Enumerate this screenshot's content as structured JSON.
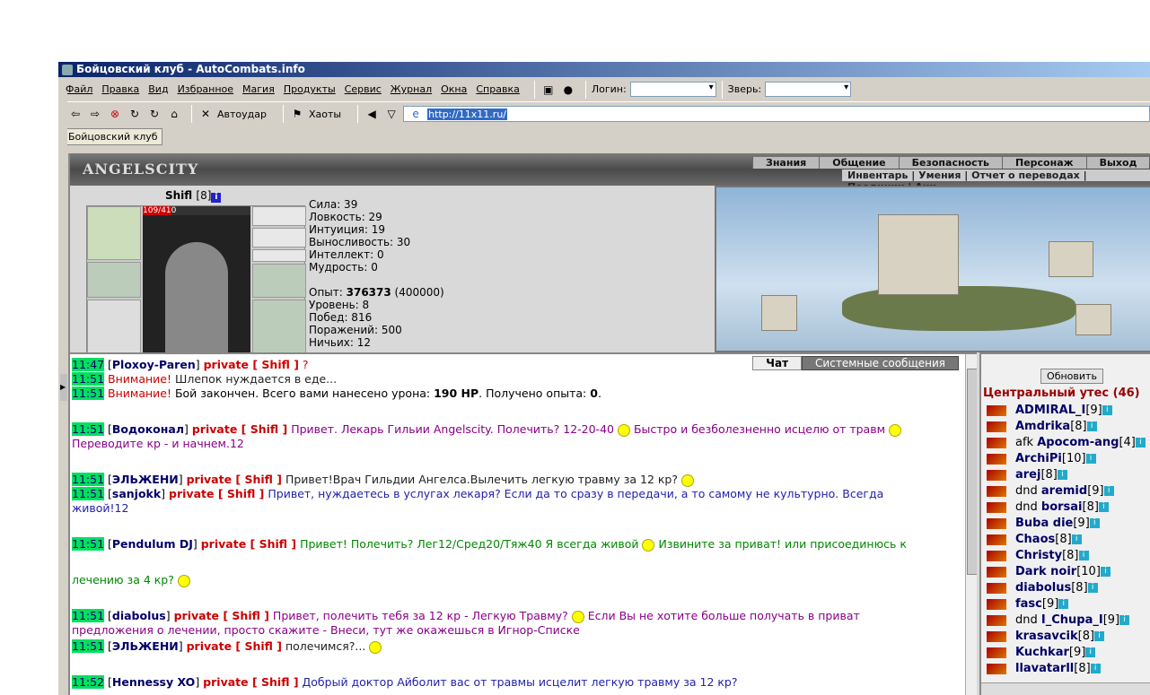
{
  "window": {
    "title": "Бойцовский клуб - AutoCombats.info"
  },
  "menu": [
    "Файл",
    "Правка",
    "Вид",
    "Избранное",
    "Магия",
    "Продукты",
    "Сервис",
    "Журнал",
    "Окна",
    "Справка"
  ],
  "toolbar": {
    "login_label": "Логин:",
    "pet_label": "Зверь:",
    "autoudar": "Автоудар",
    "haoty": "Хаоты",
    "url": "http://11x11.ru/"
  },
  "tab": "Бойцовский клуб",
  "header": {
    "logo": "ANGELSCITY",
    "nav1": [
      "Знания",
      "Общение",
      "Безопасность",
      "Персонаж",
      "Выход"
    ],
    "nav2": "Инвентарь | Умения | Отчет о переводах | Поединки | Анк"
  },
  "character": {
    "name": "Shifl",
    "level": "[8]",
    "hp": "109/410",
    "hp_fraction": 0.27
  },
  "stats": {
    "lines1": [
      "Сила: 39",
      "Ловкость: 29",
      "Интуиция: 19",
      "Выносливость: 30",
      "Интеллект: 0",
      "Мудрость: 0"
    ],
    "exp_label": "Опыт: ",
    "exp_val": "376373",
    "exp_next": " (400000)",
    "lines2": [
      "Уровень: 8",
      "Побед: 816",
      "Поражений: 500",
      "Ничьих: 12"
    ]
  },
  "chat": {
    "tab_chat": "Чат",
    "tab_sys": "Системные сообщения",
    "m1": {
      "ts": "11:47",
      "nick": "Ploxoy-Paren",
      "prv": "private [ Shifl ]",
      "text": " ?"
    },
    "m2": {
      "ts": "11:51",
      "warn": "Внимание!",
      "text": " Шлепок нуждается в еде..."
    },
    "m3": {
      "ts": "11:51",
      "warn": "Внимание!",
      "text": " Бой закончен. Всего вами нанесено урона: ",
      "b1": "190 HP",
      "t2": ". Получено опыта: ",
      "b2": "0",
      "t3": "."
    },
    "m4": {
      "ts": "11:51",
      "nick": "Водоконал",
      "prv": "private [ Shifl ]",
      "text": " Привет. Лекарь Гильии Angelscity. Полечить? 12-20-40",
      "text2": "Быстро и безболезненно исцелю от травм",
      "line2": "Переводите кр - и начнем.12"
    },
    "m5": {
      "ts": "11:51",
      "nick": "ЭЛЬЖЕНИ",
      "prv": "private [ Shifl ]",
      "text": " Привет!Врач Гильдии Ангелса.Вылечить легкую травму за 12 кр?"
    },
    "m6": {
      "ts": "11:51",
      "nick": "sanjokk",
      "prv": "private [ Shifl ]",
      "text": " Привет, нуждаетесь в услугах лекаря? Если да то сразу в передачи, а то самому не культурно. Всегда",
      "line2": "живой!12"
    },
    "m7": {
      "ts": "11:51",
      "nick": "Pendulum DJ",
      "prv": "private [ Shifl ]",
      "text": " Привет! Полечить? Лег12/Сред20/Тяж40 Я всегда живой",
      "text2": "Извините за приват! или присоединюсь к",
      "line2": "лечению за 4 кр?"
    },
    "m8": {
      "ts": "11:51",
      "nick": "diabolus",
      "prv": "private [ Shifl ]",
      "text": " Привет, полечить тебя за 12 кр - Легкую Травму?",
      "text2": "Если Вы не хотите больше получать в приват",
      "line2": "предложения о лечении, просто скажите - Внеси, тут же окажешься в Игнор-Списке"
    },
    "m9": {
      "ts": "11:51",
      "nick": "ЭЛЬЖЕНИ",
      "prv": "private [ Shifl ]",
      "text": " полечимся?..."
    },
    "m10": {
      "ts": "11:52",
      "nick": "Hennessy XO",
      "prv": "private [ Shifl ]",
      "text": " Добрый доктор Айболит вас от травмы исцелит легкую травму за 12 кр?"
    }
  },
  "users": {
    "refresh": "Обновить",
    "room": "Центральный утес (46)",
    "list": [
      {
        "pre": "",
        "nick": "ADMIRAL_I",
        "lvl": "[9]"
      },
      {
        "pre": "",
        "nick": "Amdrika",
        "lvl": "[8]"
      },
      {
        "pre": "afk ",
        "nick": "Apocom-ang",
        "lvl": "[4]"
      },
      {
        "pre": "",
        "nick": "ArchiPi",
        "lvl": "[10]"
      },
      {
        "pre": "",
        "nick": "arej",
        "lvl": "[8]"
      },
      {
        "pre": "dnd ",
        "nick": "aremid",
        "lvl": "[9]"
      },
      {
        "pre": "dnd ",
        "nick": "borsai",
        "lvl": "[8]"
      },
      {
        "pre": "",
        "nick": "Buba die",
        "lvl": "[9]"
      },
      {
        "pre": "",
        "nick": "Chaos",
        "lvl": "[8]"
      },
      {
        "pre": "",
        "nick": "Christy",
        "lvl": "[8]"
      },
      {
        "pre": "",
        "nick": "Dark noir",
        "lvl": "[10]"
      },
      {
        "pre": "",
        "nick": "diabolus",
        "lvl": "[8]"
      },
      {
        "pre": "",
        "nick": "fasc",
        "lvl": "[9]"
      },
      {
        "pre": "dnd ",
        "nick": "I_Chupa_I",
        "lvl": "[9]"
      },
      {
        "pre": "",
        "nick": "krasavcik",
        "lvl": "[8]"
      },
      {
        "pre": "",
        "nick": "Kuchkar",
        "lvl": "[9]"
      },
      {
        "pre": "",
        "nick": "llavatarll",
        "lvl": "[8]"
      }
    ]
  }
}
